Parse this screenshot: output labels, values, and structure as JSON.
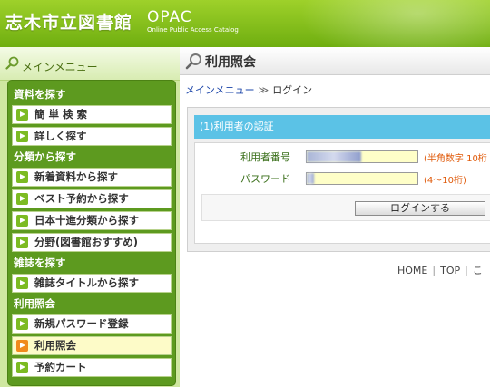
{
  "header": {
    "site_title": "志木市立図書館",
    "opac": "OPAC",
    "opac_sub": "Online Public Access Catalog"
  },
  "sidebar": {
    "title": "メインメニュー",
    "sections": [
      {
        "title": "資料を探す",
        "items": [
          "簡 単 検 索",
          "詳しく探す"
        ]
      },
      {
        "title": "分類から探す",
        "items": [
          "新着資料から探す",
          "ベスト予約から探す",
          "日本十進分類から探す",
          "分野(図書館おすすめ)"
        ]
      },
      {
        "title": "雑誌を探す",
        "items": [
          "雑誌タイトルから探す"
        ]
      },
      {
        "title": "利用照会",
        "items": [
          "新規パスワード登録",
          "利用照会",
          "予約カート"
        ]
      }
    ],
    "active_item": "利用照会"
  },
  "main": {
    "title": "利用照会",
    "breadcrumb": {
      "link": "メインメニュー",
      "sep": "≫",
      "current": "ログイン"
    },
    "login": {
      "title": "(1)利用者の認証",
      "user_label": "利用者番号",
      "user_hint": "(半角数字 10桁",
      "password_label": "パスワード",
      "password_hint": "(4〜10桁)",
      "button": "ログインする"
    },
    "footer": {
      "home": "HOME",
      "top": "TOP",
      "more": "こ",
      "sep": "|"
    }
  },
  "colors": {
    "header_green": "#7fbe1a",
    "sidebar_panel": "#5d9a1f",
    "login_title_bg": "#5bc2e6",
    "hint_orange": "#e05a0a",
    "link_blue": "#1a44a8"
  }
}
